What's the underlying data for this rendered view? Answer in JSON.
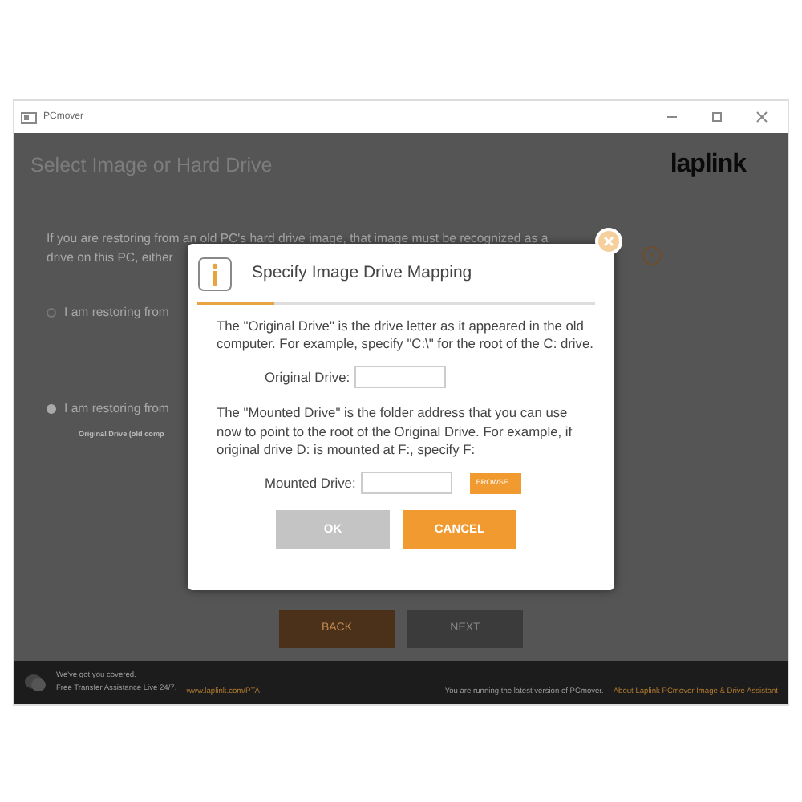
{
  "window": {
    "title": "PCmover"
  },
  "header": {
    "title": "Select Image or Hard Drive",
    "logo": "laplink"
  },
  "intro": [
    "If you are restoring from an old PC's hard drive image, that image must be recognized as a",
    "drive on this PC, either"
  ],
  "options": [
    {
      "label": "I am restoring from",
      "selected": false
    },
    {
      "label": "I am restoring from",
      "selected": true
    }
  ],
  "drive_table": {
    "column_1": "Original Drive (old comp"
  },
  "nav_buttons": [
    {
      "label": "BACK",
      "kind": "primary"
    },
    {
      "label": "NEXT",
      "kind": "secondary"
    }
  ],
  "footer": {
    "tagline": "We've got you covered.",
    "assist": "Free Transfer Assistance Live 24/7.",
    "link": "www.laplink.com/PTA",
    "version": "You are running the latest version of PCmover.",
    "about": "About Laplink PCmover Image & Drive Assistant"
  },
  "dialog": {
    "title": "Specify Image Drive Mapping",
    "sections": [
      {
        "text": "The \"Original Drive\" is the drive letter as it appeared in the old computer. For example, specify \"C:\\\" for the root of the C: drive.",
        "field": {
          "label": "Original Drive:"
        }
      },
      {
        "text": "The \"Mounted Drive\" is the folder address that you can use now to point to the root of the Original Drive. For example, if original drive D: is mounted at F:, specify F:",
        "field": {
          "label": "Mounted Drive:",
          "browse": "BROWSE..."
        }
      }
    ],
    "buttons": [
      {
        "label": "OK",
        "kind": "secondary"
      },
      {
        "label": "CANCEL",
        "kind": "primary"
      }
    ]
  }
}
